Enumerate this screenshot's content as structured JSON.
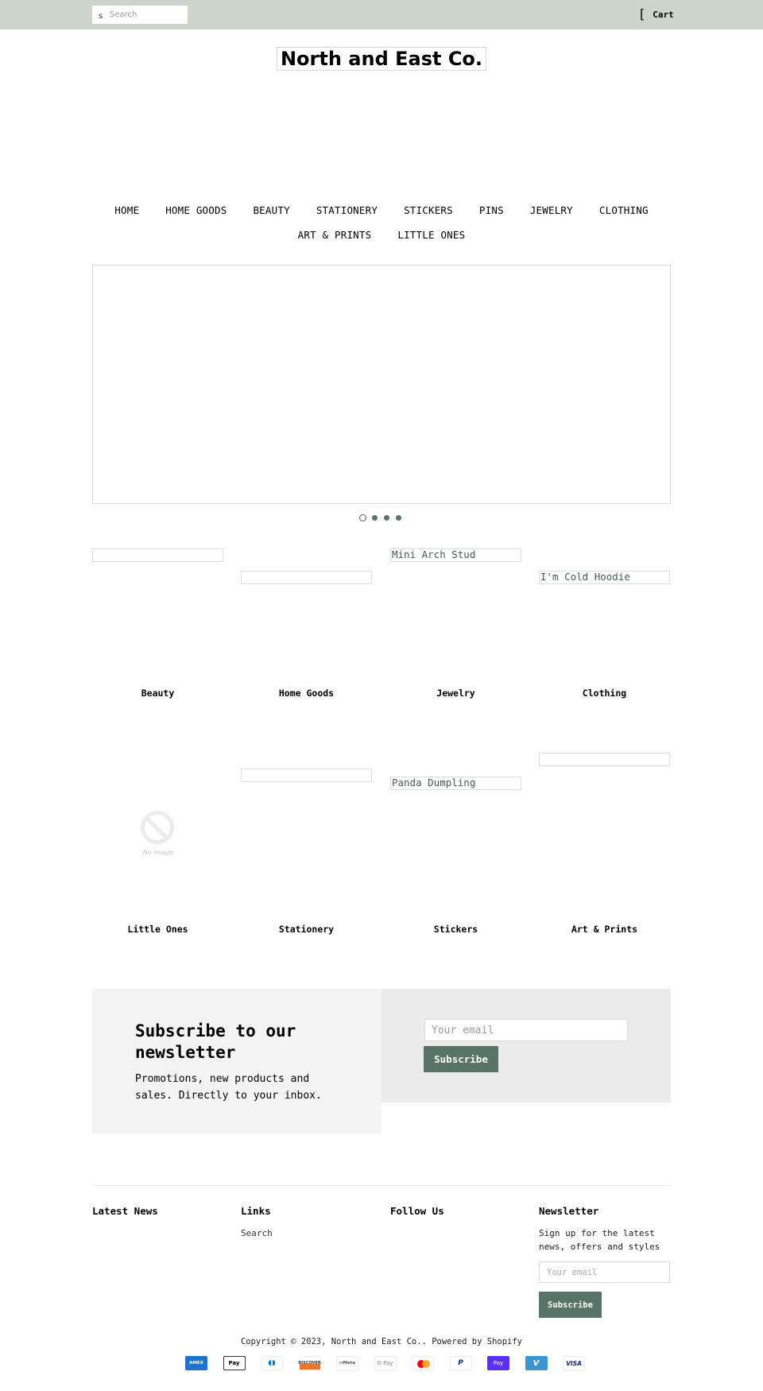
{
  "topbar": {
    "search_placeholder": "Search",
    "search_icon": "search-icon",
    "search_icon_glyph": "s",
    "cart_icon_glyph": "[",
    "cart_label": "Cart"
  },
  "logo": {
    "text": "North and East Co."
  },
  "nav": {
    "row1": [
      "HOME",
      "HOME GOODS",
      "BEAUTY",
      "STATIONERY",
      "STICKERS",
      "PINS",
      "JEWELRY",
      "CLOTHING"
    ],
    "row2": [
      "ART & PRINTS",
      "LITTLE ONES"
    ]
  },
  "slideshow": {
    "slide_count": 4,
    "active_slide": 1
  },
  "collections": [
    {
      "title": "Beauty",
      "image_alt": ""
    },
    {
      "title": "Home Goods",
      "image_alt": ""
    },
    {
      "title": "Jewelry",
      "image_alt": "Mini Arch Stud"
    },
    {
      "title": "Clothing",
      "image_alt": "I'm Cold Hoodie"
    },
    {
      "title": "Little Ones",
      "image_alt": "",
      "placeholder_text": "No image"
    },
    {
      "title": "Stationery",
      "image_alt": ""
    },
    {
      "title": "Stickers",
      "image_alt": "Panda Dumpling"
    },
    {
      "title": "Art & Prints",
      "image_alt": ""
    }
  ],
  "newsletter": {
    "heading": "Subscribe to our newsletter",
    "text": "Promotions, new products and sales. Directly to your inbox.",
    "email_placeholder": "Your email",
    "button_label": "Subscribe"
  },
  "footer": {
    "columns": [
      {
        "heading": "Latest News"
      },
      {
        "heading": "Links",
        "links": [
          "Search"
        ]
      },
      {
        "heading": "Follow Us"
      },
      {
        "heading": "Newsletter",
        "text": "Sign up for the latest news, offers and styles",
        "email_placeholder": "Your email",
        "button_label": "Subscribe"
      }
    ],
    "copyright_prefix": "Copyright © 2023, ",
    "copyright_store": "North and East Co.",
    "copyright_sep": ". ",
    "powered_by": "Powered by Shopify",
    "payment_icons": [
      {
        "name": "amex-icon",
        "label": "AMEX"
      },
      {
        "name": "apple-pay-icon",
        "label": " Pay"
      },
      {
        "name": "diners-club-icon",
        "label": "◖◗"
      },
      {
        "name": "discover-icon",
        "label": "DISCOVER"
      },
      {
        "name": "meta-pay-icon",
        "label": "∞Meta"
      },
      {
        "name": "google-pay-icon",
        "label": "G Pay"
      },
      {
        "name": "mastercard-icon",
        "label": ""
      },
      {
        "name": "paypal-icon",
        "label": "P"
      },
      {
        "name": "shop-pay-icon",
        "label": "Pay"
      },
      {
        "name": "venmo-icon",
        "label": "V"
      },
      {
        "name": "visa-icon",
        "label": "VISA"
      }
    ]
  },
  "colors": {
    "topbar_bg": "#cdd4cc",
    "accent_button": "#587468",
    "dot": "#5e736c",
    "newsletter_left_bg": "#f3f3f3",
    "newsletter_right_bg": "#ebebeb"
  }
}
